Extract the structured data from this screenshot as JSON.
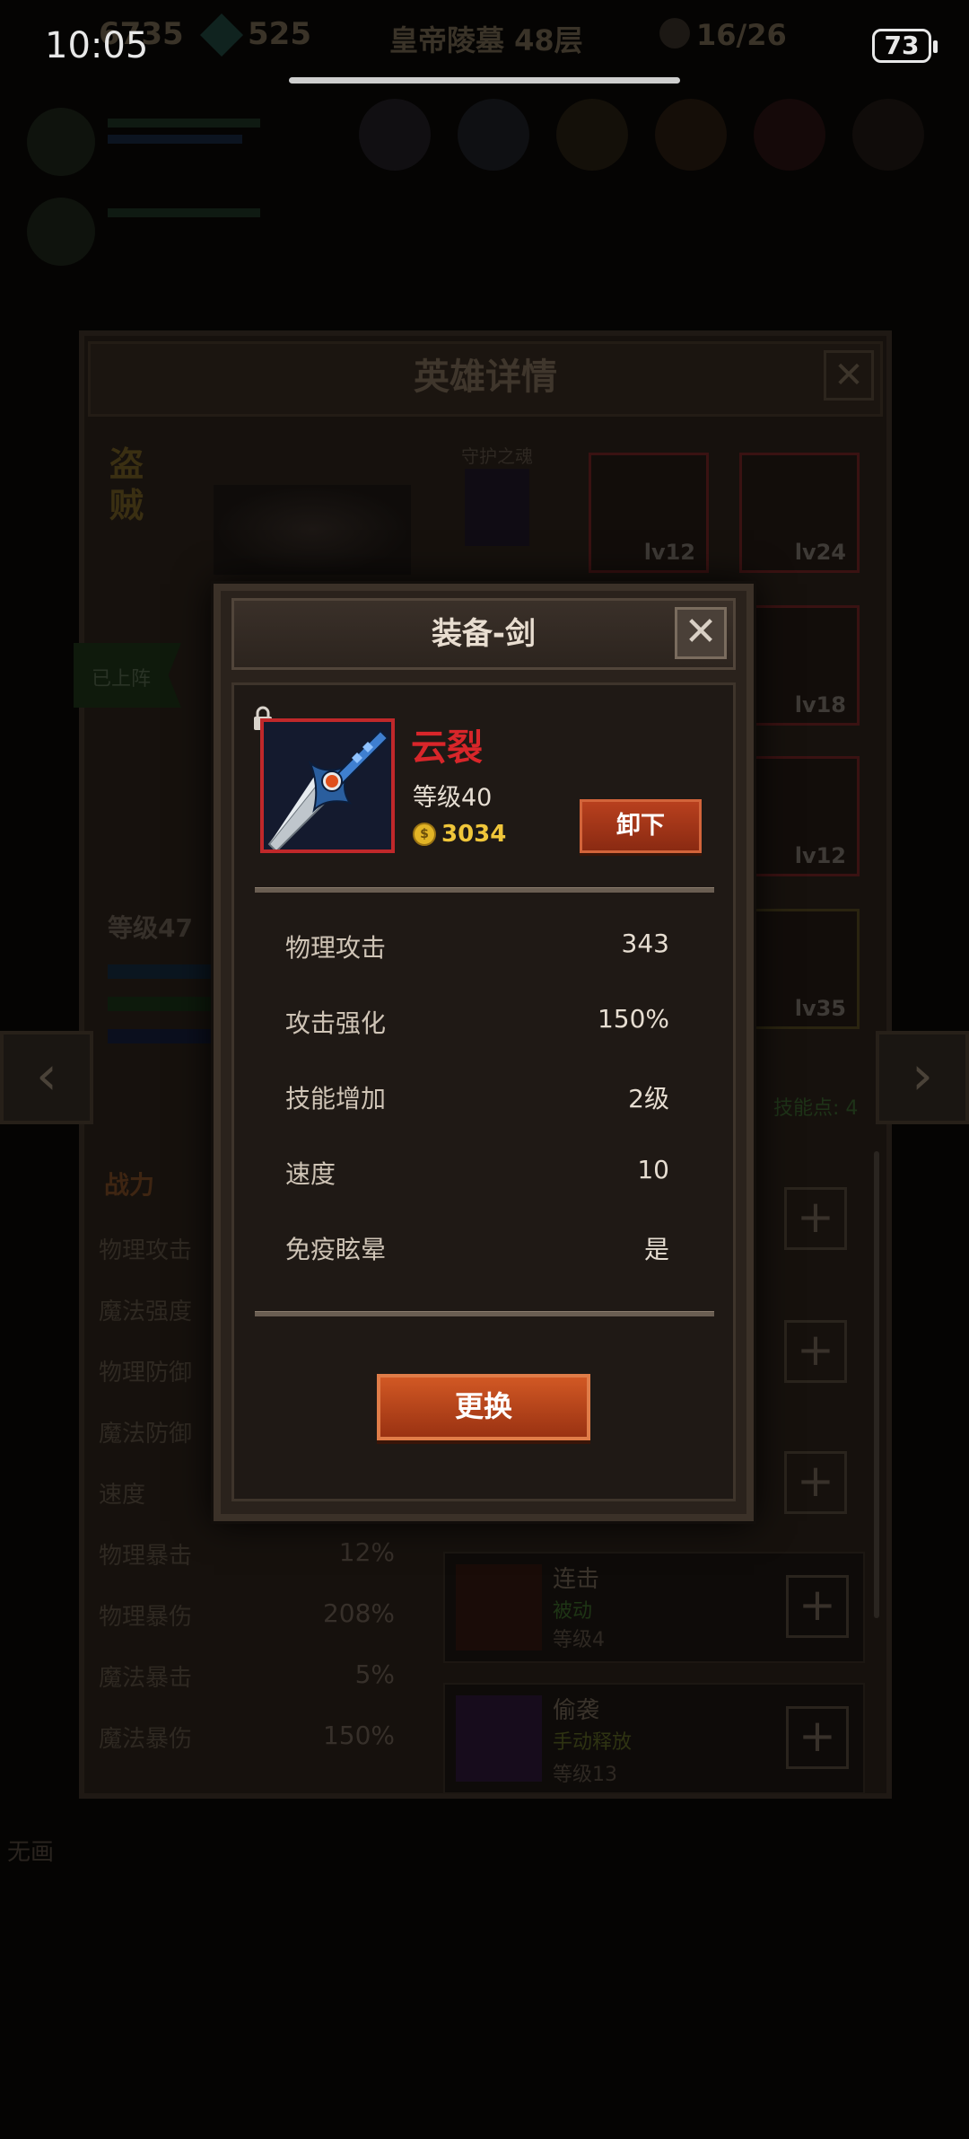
{
  "status_bar": {
    "time": "10:05",
    "battery": "73"
  },
  "background": {
    "top_bar": {
      "gold": "6735",
      "gems": "525",
      "location": "皇帝陵墓 48层",
      "progress": "16/26"
    },
    "panel_title": "英雄详情",
    "hero_class": "盗\n贼",
    "guardian_label": "守护之魂",
    "deployed_label": "已上阵",
    "hero_level": "等级47",
    "skill_points": "技能点: 4",
    "equipment_slots": [
      "lv12",
      "lv24",
      "lv18",
      "lv12",
      "lv35"
    ],
    "stats_header": "战力",
    "stats": [
      {
        "label": "物理攻击",
        "value": ""
      },
      {
        "label": "魔法强度",
        "value": ""
      },
      {
        "label": "物理防御",
        "value": ""
      },
      {
        "label": "魔法防御",
        "value": ""
      },
      {
        "label": "速度",
        "value": ""
      },
      {
        "label": "物理暴击",
        "value": "12%"
      },
      {
        "label": "物理暴伤",
        "value": "208%"
      },
      {
        "label": "魔法暴击",
        "value": "5%"
      },
      {
        "label": "魔法暴伤",
        "value": "150%"
      }
    ],
    "skills": [
      {
        "name": "连击",
        "type": "被动",
        "level": "等级4"
      },
      {
        "name": "偷袭",
        "type": "手动释放",
        "level": "等级13"
      }
    ],
    "bottom_label": "无画"
  },
  "dialog": {
    "title": "装备-剑",
    "item_name": "云裂",
    "item_level": "等级40",
    "price": "3034",
    "unequip_label": "卸下",
    "stats": [
      {
        "label": "物理攻击",
        "value": "343"
      },
      {
        "label": "攻击强化",
        "value": "150%"
      },
      {
        "label": "技能增加",
        "value": "2级"
      },
      {
        "label": "速度",
        "value": "10"
      },
      {
        "label": "免疫眩晕",
        "value": "是"
      }
    ],
    "replace_label": "更换"
  },
  "colors": {
    "item_name": "#d8262a",
    "gold": "#f0c63a",
    "button": "#b8401e"
  }
}
